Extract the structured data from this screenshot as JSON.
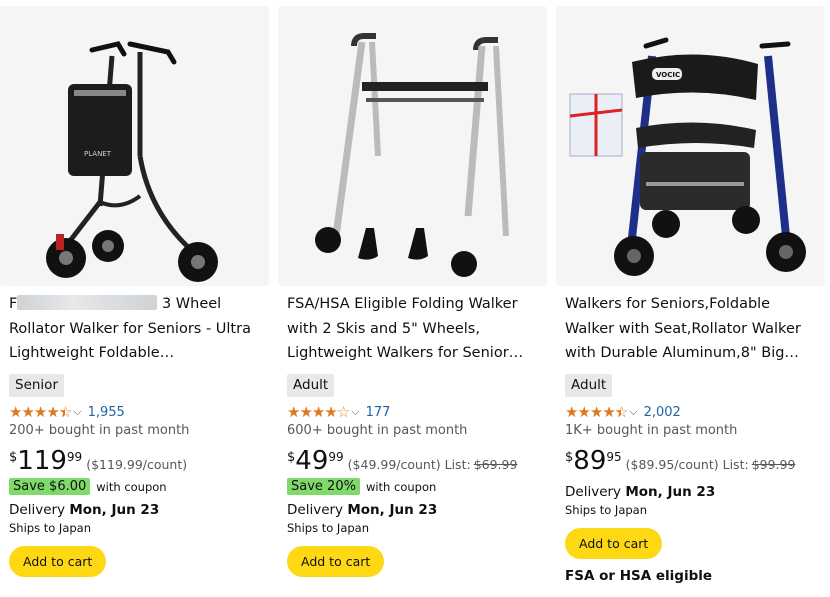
{
  "products": [
    {
      "title_visible_start": "F",
      "title_visible_mid": "3 Wheel Rollator Walker for Seniors - Ultra Lightweight Foldable…",
      "badge": "Senior",
      "rating_count": "1,955",
      "bought": "200+ bought in past month",
      "price_symbol": "$",
      "price_whole": "119",
      "price_fraction": "99",
      "unit_price": "($119.99/count)",
      "list_label": "",
      "list_price": "",
      "coupon": "Save $6.00",
      "coupon_note": "with coupon",
      "delivery_label": "Delivery",
      "delivery_date": "Mon, Jun 23",
      "ships": "Ships to Japan",
      "cart_label": "Add to cart",
      "stars": 4.5,
      "image_brand": "PLANET"
    },
    {
      "title": "FSA/HSA Eligible Folding Walker with 2 Skis and 5\" Wheels, Lightweight Walkers for Senior…",
      "badge": "Adult",
      "rating_count": "177",
      "bought": "600+ bought in past month",
      "price_symbol": "$",
      "price_whole": "49",
      "price_fraction": "99",
      "unit_price": "($49.99/count)",
      "list_label": "List:",
      "list_price": "$69.99",
      "coupon": "Save 20%",
      "coupon_note": "with coupon",
      "delivery_label": "Delivery",
      "delivery_date": "Mon, Jun 23",
      "ships": "Ships to Japan",
      "cart_label": "Add to cart",
      "stars": 4.0
    },
    {
      "title": "Walkers for Seniors,Foldable Walker with Seat,Rollator Walker with Durable Aluminum,8\" Big…",
      "badge": "Adult",
      "rating_count": "2,002",
      "bought": "1K+ bought in past month",
      "price_symbol": "$",
      "price_whole": "89",
      "price_fraction": "95",
      "unit_price": "($89.95/count)",
      "list_label": "List:",
      "list_price": "$99.99",
      "delivery_label": "Delivery",
      "delivery_date": "Mon, Jun 23",
      "ships": "Ships to Japan",
      "cart_label": "Add to cart",
      "fsa": "FSA or HSA eligible",
      "stars": 4.5,
      "image_brand": "VOCIC"
    }
  ],
  "colors": {
    "star": "#de7921",
    "link": "#2162a1",
    "coupon_bg": "#7fda69",
    "cart_bg": "#ffd814",
    "badge_bg": "#e6e8ea"
  }
}
